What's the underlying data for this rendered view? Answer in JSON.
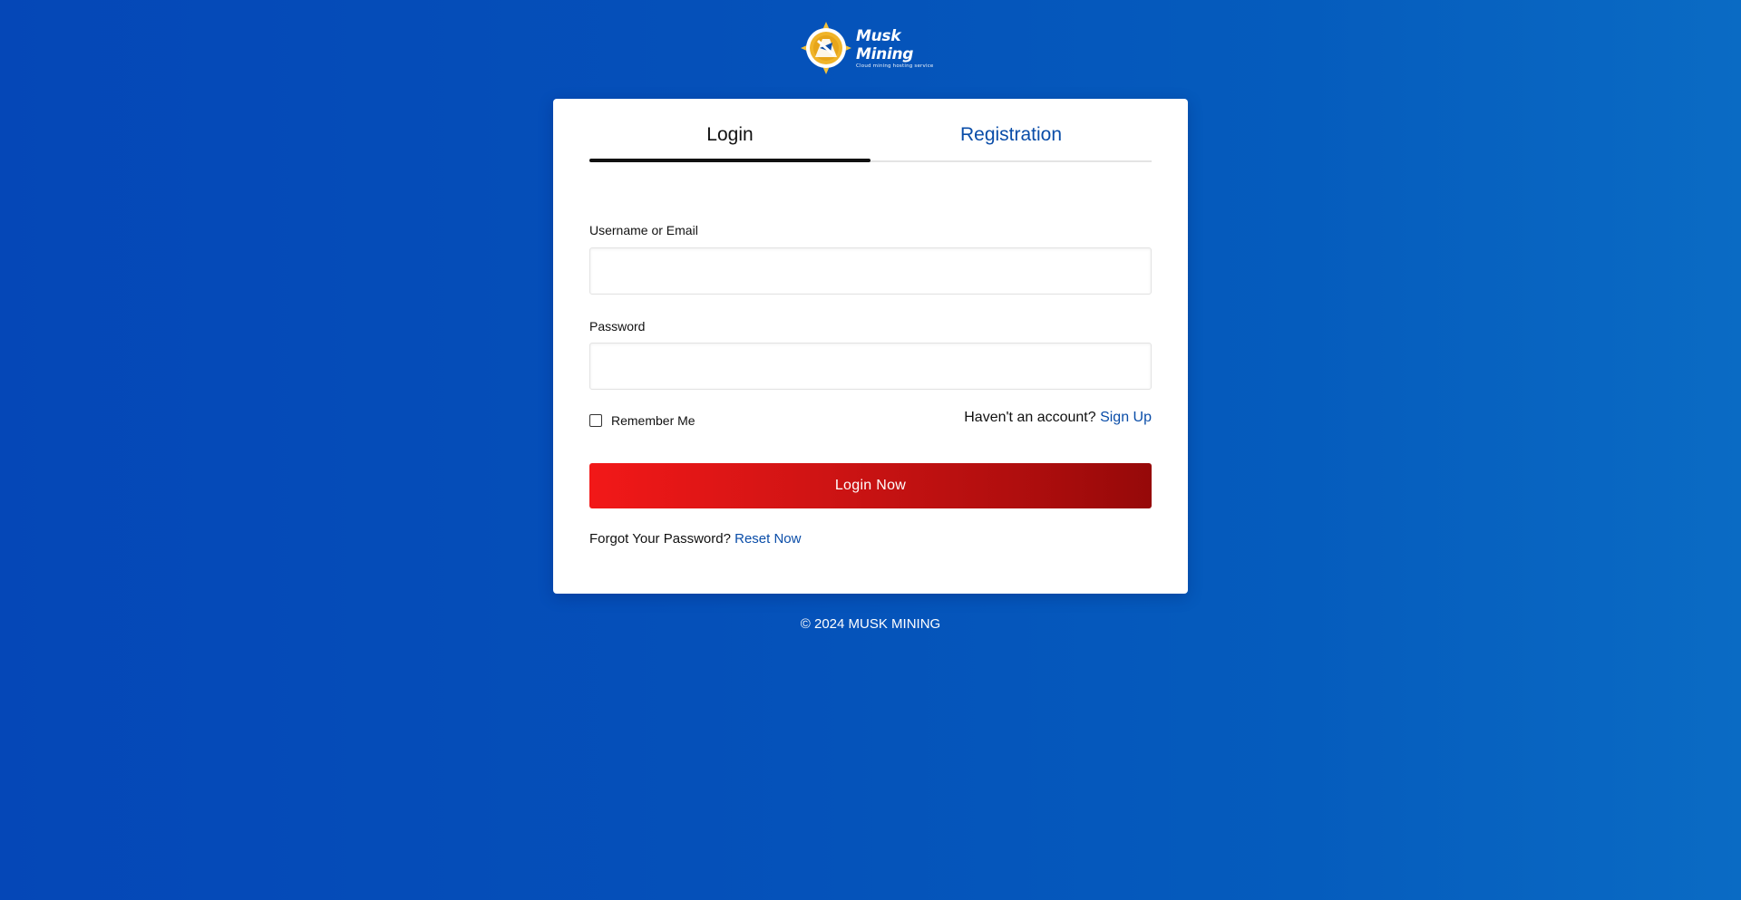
{
  "brand": {
    "name": "Musk Mining",
    "tagline": "Cloud mining hosting service",
    "colors": {
      "background": "#0550b9",
      "accent_blue": "#0a4da8",
      "button_red": "#d01414"
    }
  },
  "tabs": [
    {
      "label": "Login",
      "active": true
    },
    {
      "label": "Registration",
      "active": false
    }
  ],
  "form": {
    "username_label": "Username or Email",
    "username_value": "",
    "password_label": "Password",
    "password_value": "",
    "remember_label": "Remember Me",
    "remember_checked": false,
    "no_account_text": "Haven't an account?",
    "signup_link": "Sign Up",
    "submit_label": "Login Now",
    "forgot_text": "Forgot Your Password?",
    "reset_link": "Reset Now"
  },
  "footer": {
    "copyright": "© 2024 MUSK MINING"
  },
  "icons": {
    "logo": "mining-emblem-icon",
    "checkbox": "checkbox-unchecked-icon"
  }
}
